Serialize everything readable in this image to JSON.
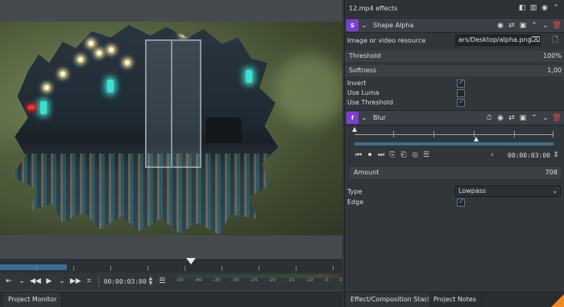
{
  "monitor": {
    "timecode": "00:00:03:00",
    "meter_scale": [
      "-50",
      "-40",
      "-35",
      "-30",
      "-25",
      "-20",
      "-15",
      "-10",
      "-5",
      "0"
    ],
    "tab_label": "Project Monitor"
  },
  "stack": {
    "title": "12.mp4 effects",
    "effects": [
      {
        "badge": "S",
        "name": "Shape Alpha",
        "resource_label": "Image or video resource",
        "resource_value": "ars/Desktop/alpha.png",
        "threshold_label": "Threshold",
        "threshold_value": "100%",
        "softness_label": "Softness",
        "softness_value": "1,00",
        "invert_label": "Invert",
        "invert_checked": true,
        "use_luma_label": "Use Luma",
        "use_luma_checked": false,
        "use_threshold_label": "Use Threshold",
        "use_threshold_checked": true
      },
      {
        "badge": "f",
        "name": "Blur",
        "timecode": "00:00:03:00",
        "amount_label": "Amount",
        "amount_value": "708",
        "type_label": "Type",
        "type_value": "Lowpass",
        "edge_label": "Edge",
        "edge_checked": true
      }
    ],
    "tabs": [
      "Effect/Composition Stack",
      "Project Notes"
    ]
  },
  "colors": {
    "accent": "#3daee9",
    "badge": "#7b3fd6",
    "delete": "#e24a4a",
    "corner": "#f08a24"
  }
}
